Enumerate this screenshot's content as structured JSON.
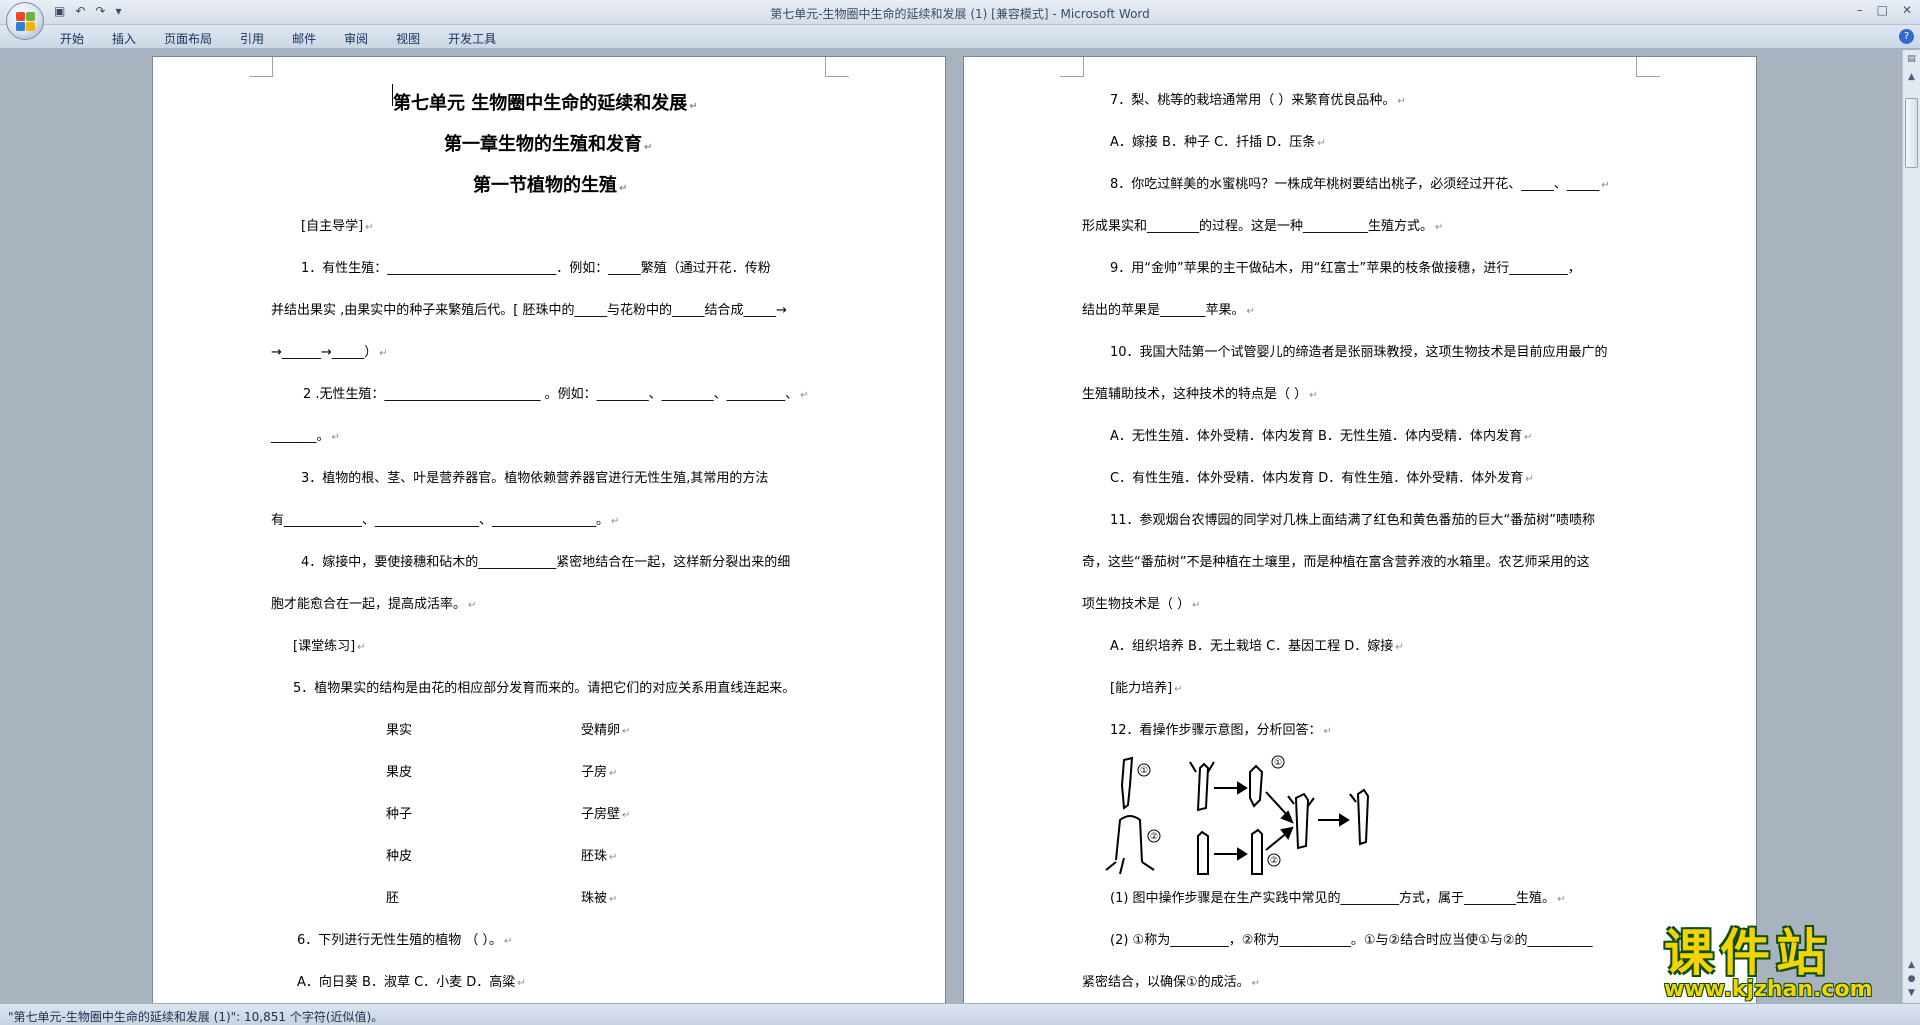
{
  "window": {
    "title": "第七单元-生物圈中生命的延续和发展 (1) [兼容模式] - Microsoft Word",
    "quick_access": [
      "save-icon",
      "undo-icon",
      "redo-icon",
      "customize-icon"
    ],
    "controls": [
      "minimize-icon",
      "maximize-icon",
      "close-icon"
    ]
  },
  "ribbon": {
    "tabs": [
      "开始",
      "插入",
      "页面布局",
      "引用",
      "邮件",
      "审阅",
      "视图",
      "开发工具"
    ],
    "help": "?"
  },
  "left_page": {
    "lines": [
      "第七单元  生物圈中生命的延续和发展",
      "第一章生物的生殖和发育",
      "第一节植物的生殖",
      "[自主导学]",
      "1．有性生殖：__________________________．例如：_____繁殖（通过开花．传粉",
      "并结出果实 ,由果实中的种子来繁殖后代。[ 胚珠中的_____与花粉中的_____结合成_____→",
      "→______→_____）",
      "2 .无性生殖：________________________ 。例如：________、________、_________、",
      "_______。",
      "3．植物的根、茎、叶是营养器官。植物依赖营养器官进行无性生殖,其常用的方法",
      "有____________、________________、________________。",
      "4．嫁接中，要使接穗和砧木的____________紧密地结合在一起，这样新分裂出来的细",
      "胞才能愈合在一起，提高成活率。",
      "[课堂练习]",
      "5．植物果实的结构是由花的相应部分发育而来的。请把它们的对应关系用直线连起来。",
      "6．下列进行无性生殖的植物 （        ）。",
      "A．向日葵            B．淑草           C．小麦             D．高粱"
    ],
    "match_left": [
      "果实",
      "果皮",
      "种子",
      "种皮",
      "胚"
    ],
    "match_right": [
      "受精卵",
      "子房",
      "子房壁",
      "胚珠",
      "珠被"
    ]
  },
  "right_page": {
    "lines": [
      "7．梨、桃等的栽培通常用（        ）来繁育优良品种。",
      "A．嫁接              B．种子          C．扦插            D．压条",
      "8．你吃过鲜美的水蜜桃吗？一株成年桃树要结出桃子，必须经过开花、_____、_____",
      "形成果实和________的过程。这是一种__________生殖方式。",
      "9．用“金帅”苹果的主干做砧木，用“红富士”苹果的枝条做接穗，进行_________，",
      "结出的苹果是_______苹果。",
      "10．我国大陆第一个试管婴儿的缔造者是张丽珠教授，这项生物技术是目前应用最广的",
      "生殖辅助技术，这种技术的特点是（        ）",
      "A．无性生殖．体外受精．体内发育   B．无性生殖．体内受精．体内发育",
      "C．有性生殖．体外受精．体内发育   D．有性生殖．体外受精．体外发育",
      "11．参观烟台农博园的同学对几株上面结满了红色和黄色番茄的巨大“番茄树”啧啧称",
      "奇，这些“番茄树”不是种植在土壤里，而是种植在富含营养液的水箱里。农艺师采用的这",
      "项生物技术是（        ）",
      "A．组织培养   B．无土栽培   C．基因工程   D．嫁接",
      "[能力培养]",
      "12．看操作步骤示意图，分析回答：",
      "(1) 图中操作步骤是在生产实践中常见的_________方式，属于________生殖。",
      "(2) ①称为_________，②称为___________。①与②结合时应当使①与②的__________",
      "紧密结合，以确保①的成活。"
    ],
    "diagram_labels": [
      "①",
      "②",
      "①",
      "②"
    ]
  },
  "status": {
    "text": "\"第七单元-生物圈中生命的延续和发展 (1)\": 10,851 个字符(近似值)。"
  },
  "watermark": {
    "cn": "课件站",
    "en": "www.kjzhan.com"
  }
}
